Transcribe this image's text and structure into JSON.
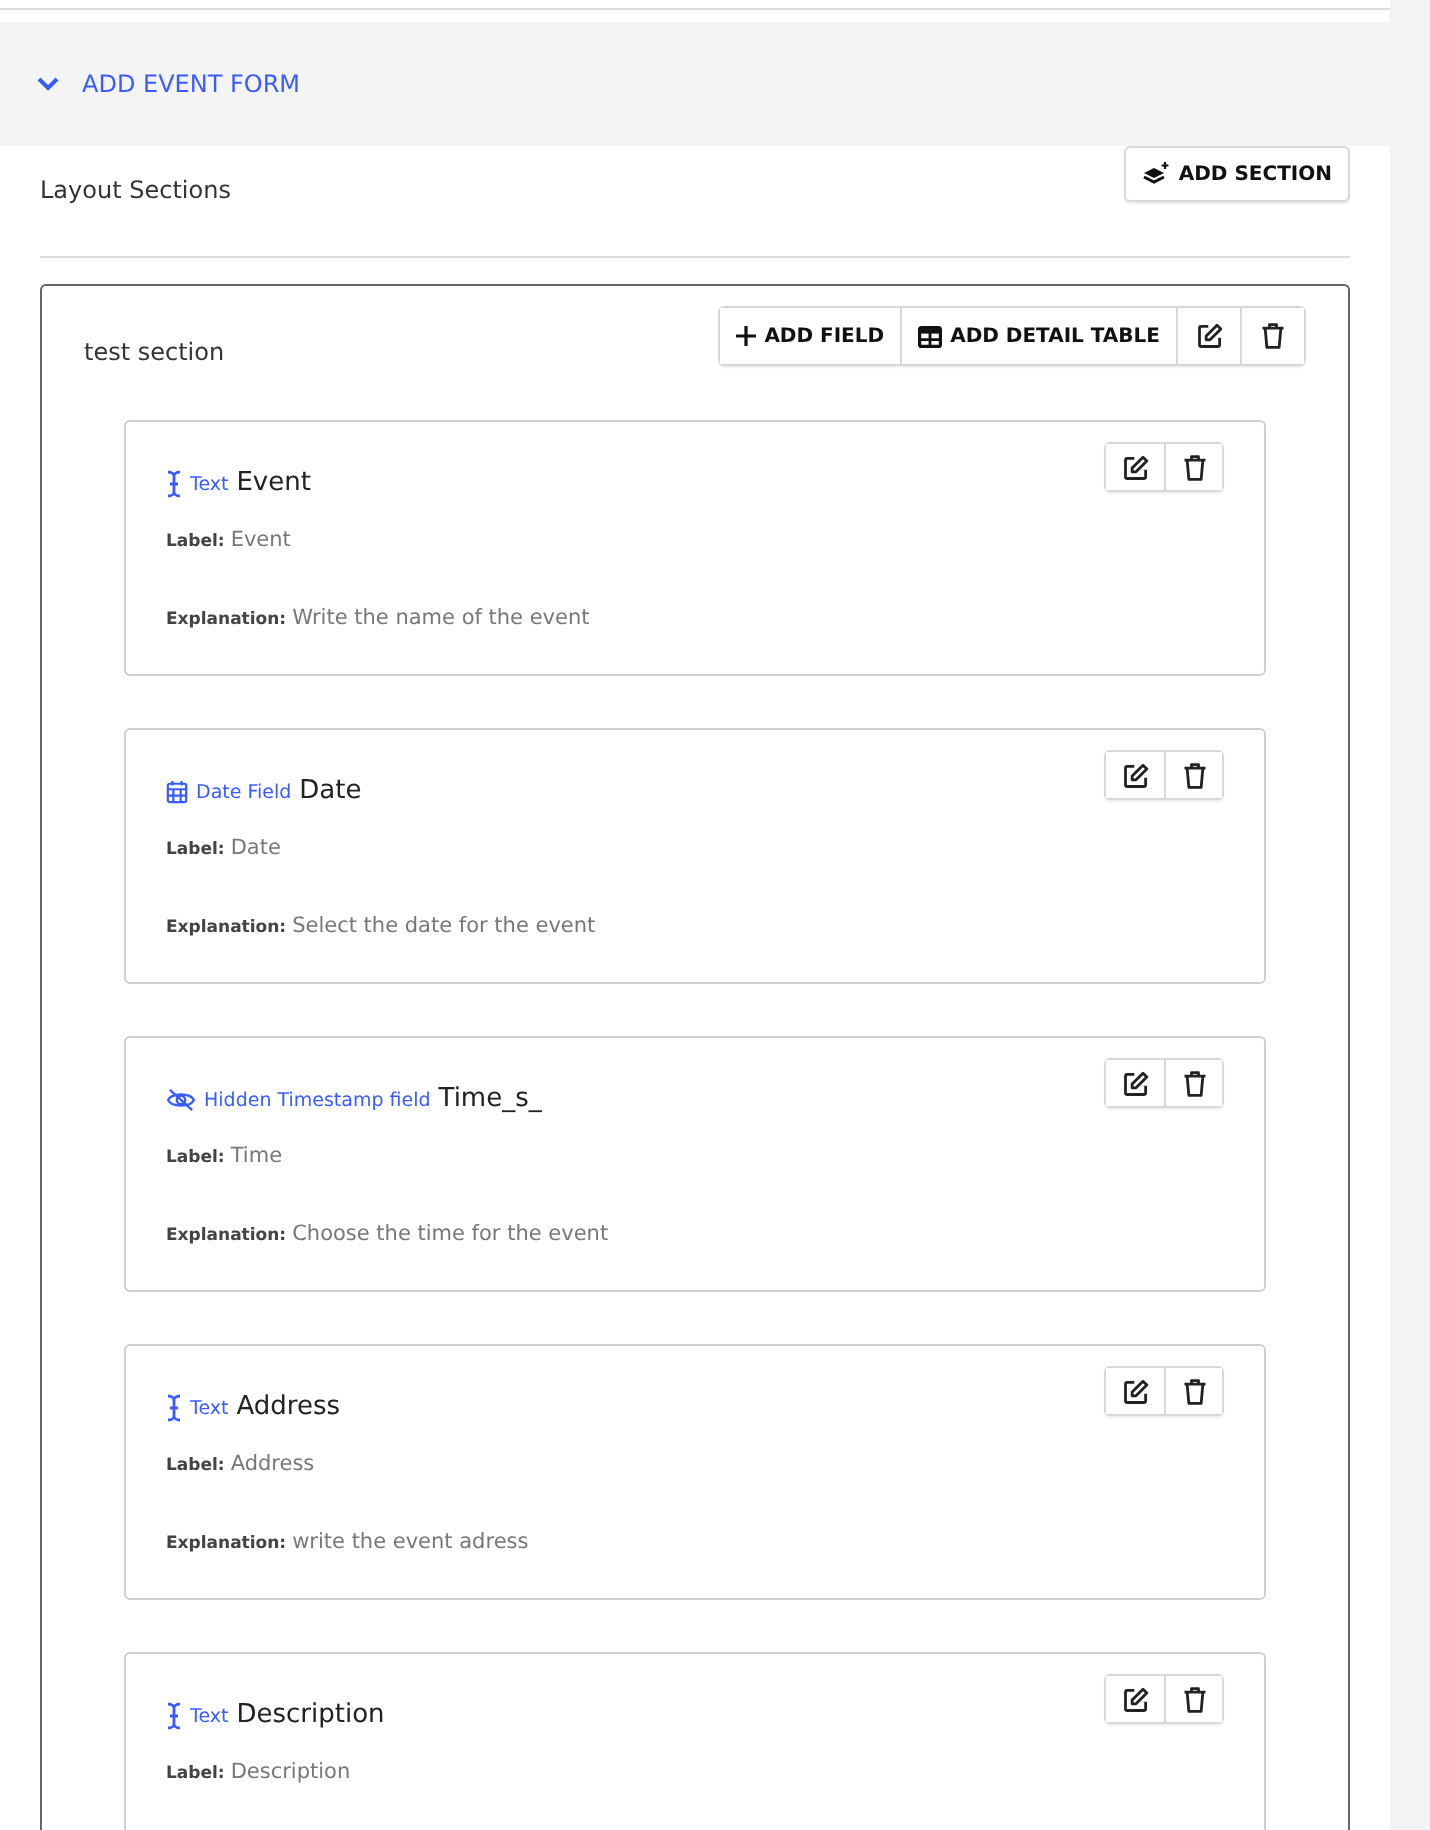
{
  "form_header": {
    "title": "ADD EVENT FORM",
    "expanded": true
  },
  "layout": {
    "title": "Layout Sections",
    "add_section_button": "ADD SECTION"
  },
  "section": {
    "name": "test section",
    "add_field_button": "ADD FIELD",
    "add_detail_table_button": "ADD DETAIL TABLE",
    "fields": [
      {
        "kind": "text",
        "type_label": "Text",
        "name": "Event",
        "label_caption": "Label:",
        "label": "Event",
        "explanation_caption": "Explanation:",
        "explanation": "Write the name of the event"
      },
      {
        "kind": "date",
        "type_label": "Date Field",
        "name": "Date",
        "label_caption": "Label:",
        "label": "Date",
        "explanation_caption": "Explanation:",
        "explanation": "Select the date for the event"
      },
      {
        "kind": "hidden",
        "type_label": "Hidden Timestamp field",
        "name": "Time_s_",
        "label_caption": "Label:",
        "label": "Time",
        "explanation_caption": "Explanation:",
        "explanation": "Choose the time for the event"
      },
      {
        "kind": "text",
        "type_label": "Text",
        "name": "Address",
        "label_caption": "Label:",
        "label": "Address",
        "explanation_caption": "Explanation:",
        "explanation": "write the event adress"
      },
      {
        "kind": "text",
        "type_label": "Text",
        "name": "Description",
        "label_caption": "Label:",
        "label": "Description"
      }
    ]
  }
}
